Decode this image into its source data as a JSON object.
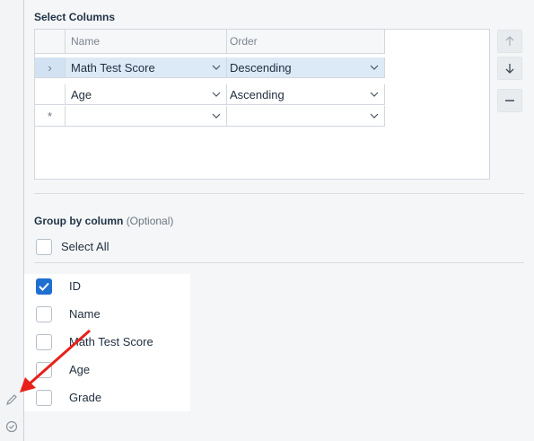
{
  "select_columns": {
    "title": "Select Columns",
    "headers": {
      "name": "Name",
      "order": "Order"
    },
    "rows": [
      {
        "indicator": "›",
        "name": "Math Test Score",
        "order": "Descending",
        "selected": true
      },
      {
        "indicator": "",
        "name": "Age",
        "order": "Ascending",
        "selected": false
      },
      {
        "indicator": "*",
        "name": "",
        "order": "",
        "selected": false
      }
    ],
    "buttons": [
      "arrow-up-icon",
      "arrow-down-icon",
      "minus-icon"
    ]
  },
  "group_by": {
    "title": "Group by column",
    "optional": "(Optional)",
    "select_all_label": "Select All",
    "columns": [
      {
        "label": "ID",
        "checked": true
      },
      {
        "label": "Name",
        "checked": false
      },
      {
        "label": "Math Test Score",
        "checked": false
      },
      {
        "label": "Age",
        "checked": false
      },
      {
        "label": "Grade",
        "checked": false
      }
    ]
  },
  "gutter_icons": [
    "pencil-icon",
    "check-circle-icon"
  ],
  "colors": {
    "accent": "#1f6fd0",
    "selected_row": "#dce9f6",
    "annotation_arrow": "#e8201a"
  }
}
